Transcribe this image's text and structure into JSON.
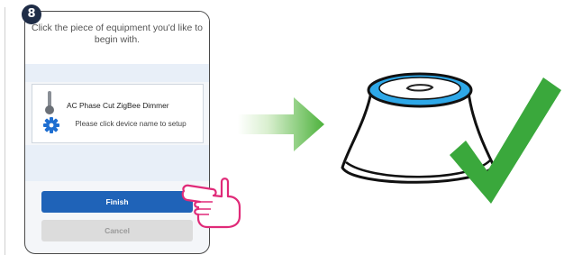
{
  "step": {
    "number": "8"
  },
  "dialog": {
    "instruction": "Click the piece of equipment you'd like to begin with.",
    "device": {
      "name": "AC Phase Cut ZigBee Dimmer",
      "hint": "Please click device name to setup",
      "type_icon": "thermometer-icon",
      "settings_icon": "gear-icon"
    },
    "finish_label": "Finish",
    "cancel_label": "Cancel"
  },
  "colors": {
    "primary_button": "#1f63b8",
    "disabled_button": "#dcdcdc",
    "hand_outline": "#e02a78",
    "arrow_start": "#e8f4e0",
    "arrow_end": "#4db23c",
    "hub_ring": "#2ea8e8",
    "checkmark": "#3aa83c",
    "badge": "#1f2d47"
  },
  "illustrations": [
    "pointing-hand-icon",
    "green-arrow-icon",
    "smart-hub-icon",
    "checkmark-icon"
  ]
}
